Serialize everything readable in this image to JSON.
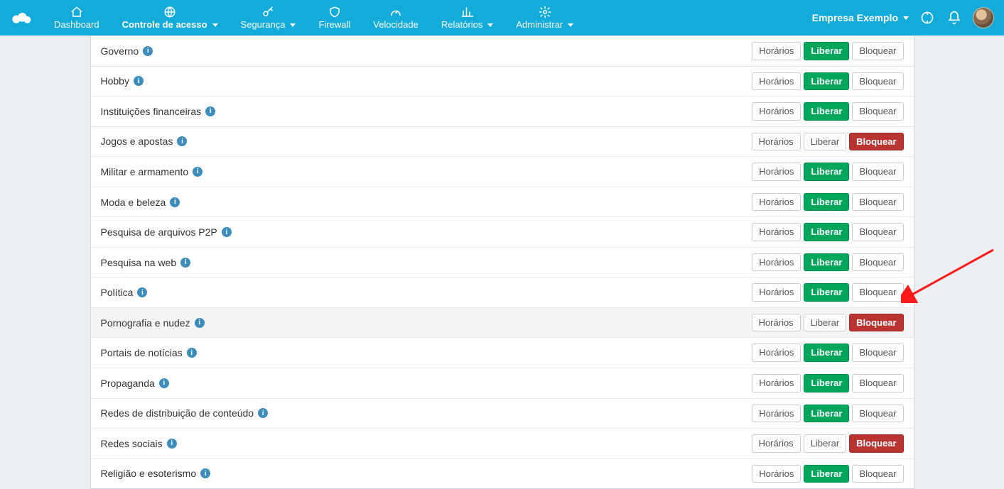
{
  "nav": {
    "items": [
      {
        "label": "Dashboard",
        "icon": "home",
        "caret": false,
        "active": false
      },
      {
        "label": "Controle de acesso",
        "icon": "globe",
        "caret": true,
        "active": true
      },
      {
        "label": "Segurança",
        "icon": "key",
        "caret": true,
        "active": false
      },
      {
        "label": "Firewall",
        "icon": "shield",
        "caret": false,
        "active": false
      },
      {
        "label": "Velocidade",
        "icon": "gauge",
        "caret": false,
        "active": false
      },
      {
        "label": "Relatórios",
        "icon": "chart",
        "caret": true,
        "active": false
      },
      {
        "label": "Administrar",
        "icon": "gear",
        "caret": true,
        "active": false
      }
    ]
  },
  "header_right": {
    "company": "Empresa Exemplo"
  },
  "buttons": {
    "horarios": "Horários",
    "liberar": "Liberar",
    "bloquear": "Bloquear"
  },
  "categories": [
    {
      "label": "Governo",
      "state": "liberar",
      "highlight": false
    },
    {
      "label": "Hobby",
      "state": "liberar",
      "highlight": false
    },
    {
      "label": "Instituições financeiras",
      "state": "liberar",
      "highlight": false
    },
    {
      "label": "Jogos e apostas",
      "state": "bloquear",
      "highlight": false
    },
    {
      "label": "Militar e armamento",
      "state": "liberar",
      "highlight": false
    },
    {
      "label": "Moda e beleza",
      "state": "liberar",
      "highlight": false
    },
    {
      "label": "Pesquisa de arquivos P2P",
      "state": "liberar",
      "highlight": false
    },
    {
      "label": "Pesquisa na web",
      "state": "liberar",
      "highlight": false
    },
    {
      "label": "Política",
      "state": "liberar",
      "highlight": false
    },
    {
      "label": "Pornografia e nudez",
      "state": "bloquear",
      "highlight": true
    },
    {
      "label": "Portais de notícias",
      "state": "liberar",
      "highlight": false
    },
    {
      "label": "Propaganda",
      "state": "liberar",
      "highlight": false
    },
    {
      "label": "Redes de distribuição de conteúdo",
      "state": "liberar",
      "highlight": false
    },
    {
      "label": "Redes sociais",
      "state": "bloquear",
      "highlight": false
    },
    {
      "label": "Religião e esoterismo",
      "state": "liberar",
      "highlight": false
    }
  ]
}
